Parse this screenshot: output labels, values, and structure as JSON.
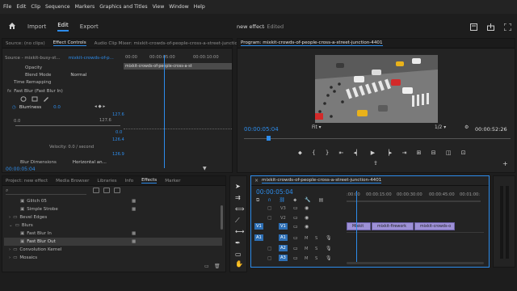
{
  "menu": [
    "File",
    "Edit",
    "Clip",
    "Sequence",
    "Markers",
    "Graphics and Titles",
    "View",
    "Window",
    "Help"
  ],
  "workspaces": {
    "import": "Import",
    "edit": "Edit",
    "export": "Export"
  },
  "project_title": "new effect",
  "edited_label": "- Edited",
  "source_panel": {
    "tabs": [
      "Source: (no clips)",
      "Effect Controls",
      "Audio Clip Mixer: mixkit-crowds-of-people-cross-a-street-junction-4401"
    ],
    "source_line": "Source - mixkit-busy-st...",
    "clip_name": "mixkit-crowds-of-p...",
    "tc_ruler": [
      "00:00",
      "00:00:05:00",
      "00:00:10:00"
    ],
    "clip_label": "mixkit-crowds-of-people-cross-a-st",
    "rows": {
      "opacity": "Opacity",
      "blend_mode": "Blend Mode",
      "blend_value": "Normal",
      "time_remap": "Time Remapping",
      "fast_blur": "Fast Blur (Fast Blur In)",
      "blurriness": "Blurriness",
      "blurriness_value": "0.0",
      "graph_max": "127.6",
      "graph_min": "0.0",
      "right_val1": "127.6",
      "right_val2": "0.0",
      "right_val3": "126.4",
      "right_val4": "126.9",
      "velocity": "Velocity: 0.0 / second",
      "blur_dimensions": "Blur Dimensions",
      "blur_dim_value": "Horizontal an..."
    },
    "timecode": "00:00:05:04"
  },
  "program": {
    "title": "Program: mixkit-crowds-of-people-cross-a-street-junction-4401",
    "timecode": "00:00:05:04",
    "fit": "Fit",
    "ratio": "1/2",
    "duration": "00:00:52:26"
  },
  "project_panel": {
    "tabs": [
      "Project: new effect",
      "Media Browser",
      "Libraries",
      "Info",
      "Effects",
      "Marker"
    ],
    "items": [
      {
        "label": "Glitch 05",
        "indent": 1
      },
      {
        "label": "Simple Strobe",
        "indent": 1
      },
      {
        "label": "Bevel Edges",
        "indent": 0
      },
      {
        "label": "Blurs",
        "indent": 0
      },
      {
        "label": "Fast Blur In",
        "indent": 1
      },
      {
        "label": "Fast Blur Out",
        "indent": 1
      },
      {
        "label": "Convolution Kernel",
        "indent": 0
      },
      {
        "label": "Mosaics",
        "indent": 0
      }
    ]
  },
  "timeline": {
    "tab": "mixkit-crowds-of-people-cross-a-street-junction-4401",
    "timecode": "00:00:05:04",
    "ruler": [
      ":00:00",
      "00:00:15:00",
      "00:00:30:00",
      "00:00:45:00",
      "00:01:00:"
    ],
    "tracks_v": [
      "V3",
      "V2",
      "V1"
    ],
    "tracks_a": [
      "A1",
      "A2",
      "A3"
    ],
    "track_patch": [
      "V1",
      "A1"
    ],
    "clips": [
      "Mixkit",
      "mixkit-firework",
      "mixkit-crowds-o"
    ]
  },
  "colors": {
    "accent": "#2d8ceb",
    "clip": "#9d90d6",
    "panel": "#232323",
    "bg": "#1d1d1d",
    "playhead": "#2d8ceb"
  }
}
